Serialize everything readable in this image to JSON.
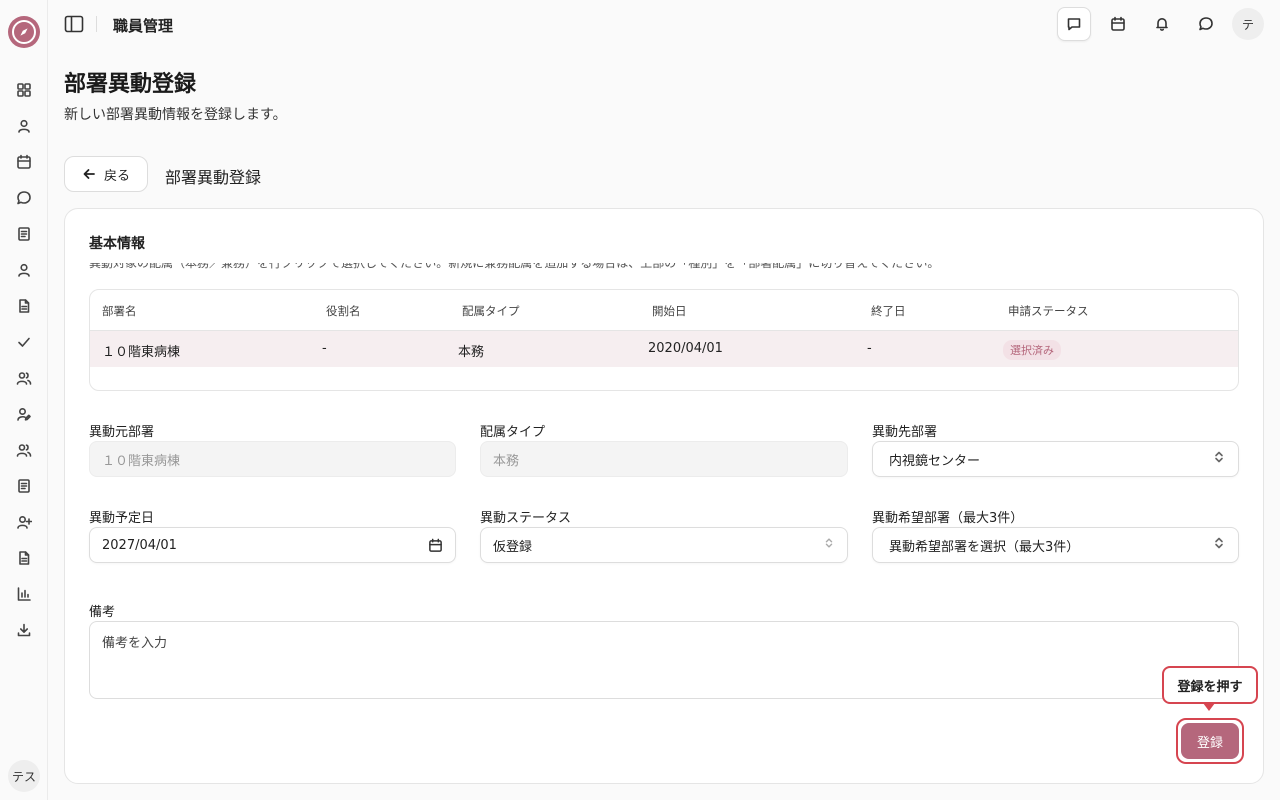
{
  "sidebar": {
    "logo_icon": "compass-icon",
    "items": [
      {
        "icon": "dashboard-icon"
      },
      {
        "icon": "user-icon"
      },
      {
        "icon": "calendar-icon"
      },
      {
        "icon": "chat-icon"
      },
      {
        "icon": "document-icon"
      },
      {
        "icon": "user-icon"
      },
      {
        "icon": "file-icon"
      },
      {
        "icon": "check-icon"
      },
      {
        "icon": "users-icon"
      },
      {
        "icon": "user-edit-icon"
      },
      {
        "icon": "users-icon"
      },
      {
        "icon": "document-icon"
      },
      {
        "icon": "user-plus-icon"
      },
      {
        "icon": "file-icon"
      },
      {
        "icon": "bar-chart-icon"
      },
      {
        "icon": "download-icon"
      }
    ],
    "avatar_text": "テス"
  },
  "header": {
    "app_title": "職員管理",
    "avatar_text": "テ"
  },
  "page": {
    "title": "部署異動登録",
    "description": "新しい部署異動情報を登録します。",
    "back_label": "戻る",
    "subtitle": "部署異動登録"
  },
  "card": {
    "title": "基本情報",
    "hint": "異動対象の配属（本務／兼務）を行クリックで選択してください。新規に兼務配属を追加する場合は、上部の「種別」を「部署配属」に切り替えてください。",
    "table": {
      "headers": [
        "部署名",
        "役割名",
        "配属タイプ",
        "開始日",
        "終了日",
        "申請ステータス"
      ],
      "row": {
        "department": "１０階東病棟",
        "role": "-",
        "type": "本務",
        "start": "2020/04/01",
        "end": "-",
        "status": "選択済み"
      }
    },
    "fields": {
      "from_dept": {
        "label": "異動元部署",
        "value": "１０階東病棟"
      },
      "assign_type": {
        "label": "配属タイプ",
        "value": "本務"
      },
      "to_dept": {
        "label": "異動先部署",
        "value": "内視鏡センター"
      },
      "planned_date": {
        "label": "異動予定日",
        "value": "2027/04/01"
      },
      "status": {
        "label": "異動ステータス",
        "value": "仮登録"
      },
      "preferred": {
        "label": "異動希望部署（最大3件）",
        "value": "異動希望部署を選択（最大3件）"
      },
      "remarks": {
        "label": "備考",
        "placeholder": "備考を入力"
      }
    },
    "tooltip": "登録を押す",
    "submit_label": "登録"
  },
  "colors": {
    "accent": "#b5677c",
    "highlight": "#d64550",
    "selected_row": "#f6eef0"
  }
}
